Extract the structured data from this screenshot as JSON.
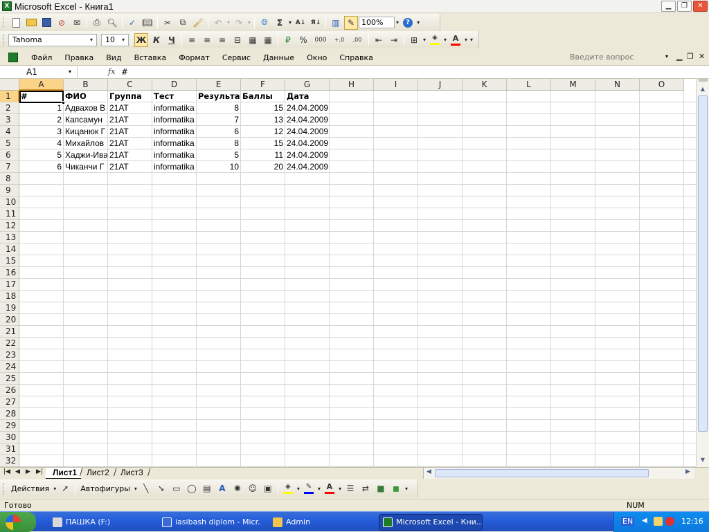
{
  "window": {
    "title": "Microsoft Excel - Книга1",
    "app_icon": "excel-icon",
    "controls": [
      "minimize-icon",
      "restore-icon",
      "close-icon"
    ]
  },
  "toolbar_standard": {
    "zoom": "100%",
    "sum_symbol": "Σ",
    "help_icon": "?"
  },
  "toolbar_format": {
    "font_name": "Tahoma",
    "font_size": "10",
    "bold": "Ж",
    "italic": "К",
    "underline": "Ч",
    "percent": "%",
    "thousands": "000",
    "inc_decimal": "+,0",
    "dec_decimal": ",00",
    "fill_color": "#ffff00",
    "font_color": "#ff0000"
  },
  "menu": {
    "items": [
      "Файл",
      "Правка",
      "Вид",
      "Вставка",
      "Формат",
      "Сервис",
      "Данные",
      "Окно",
      "Справка"
    ],
    "help_placeholder": "Введите вопрос"
  },
  "formula_bar": {
    "name_box": "A1",
    "fx": "fx",
    "content": "#"
  },
  "sheet": {
    "columns": [
      "A",
      "B",
      "C",
      "D",
      "E",
      "F",
      "G",
      "H",
      "I",
      "J",
      "K",
      "L",
      "M",
      "N",
      "O"
    ],
    "rows": [
      "1",
      "2",
      "3",
      "4",
      "5",
      "6",
      "7",
      "8",
      "9",
      "10",
      "11",
      "12",
      "13",
      "14",
      "15",
      "16",
      "17",
      "18",
      "19",
      "20",
      "21",
      "22",
      "23",
      "24",
      "25",
      "26",
      "27",
      "28",
      "29",
      "30",
      "31",
      "32"
    ],
    "selected_cell": "A1",
    "header": [
      "#",
      "ФИО",
      "Группа",
      "Тест",
      "Результат",
      "Баллы",
      "Дата"
    ],
    "data": [
      [
        "1",
        "Адвахов В",
        "21АТ",
        "informatika",
        "8",
        "15",
        "24.04.2009"
      ],
      [
        "2",
        "Капсамун",
        "21АТ",
        "informatika",
        "7",
        "13",
        "24.04.2009"
      ],
      [
        "3",
        "Кицанюк Г",
        "21АТ",
        "informatika",
        "6",
        "12",
        "24.04.2009"
      ],
      [
        "4",
        "Михайлов",
        "21АТ",
        "informatika",
        "8",
        "15",
        "24.04.2009"
      ],
      [
        "5",
        "Хаджи-Ива",
        "21АТ",
        "informatika",
        "5",
        "11",
        "24.04.2009"
      ],
      [
        "6",
        "Чиканчи Г",
        "21АТ",
        "informatika",
        "10",
        "20",
        "24.04.2009"
      ]
    ]
  },
  "sheet_tabs": [
    "Лист1",
    "Лист2",
    "Лист3"
  ],
  "active_tab": "Лист1",
  "drawing_toolbar": {
    "actions": "Действия",
    "autoshapes": "Автофигуры",
    "fill_color": "#ffff00",
    "line_color": "#0000ff",
    "font_color": "#ff0000"
  },
  "status": {
    "ready": "Готово",
    "num": "NUM"
  },
  "taskbar": {
    "buttons": [
      {
        "label": "ПАШКА (F:)",
        "icon": "drive-icon"
      },
      {
        "label": "iasibash diplom - Micr...",
        "icon": "word-icon"
      },
      {
        "label": "Admin",
        "icon": "folder-icon"
      },
      {
        "label": "Microsoft Excel - Кни...",
        "icon": "excel-icon"
      }
    ],
    "lang": "EN",
    "clock": "12:16"
  }
}
